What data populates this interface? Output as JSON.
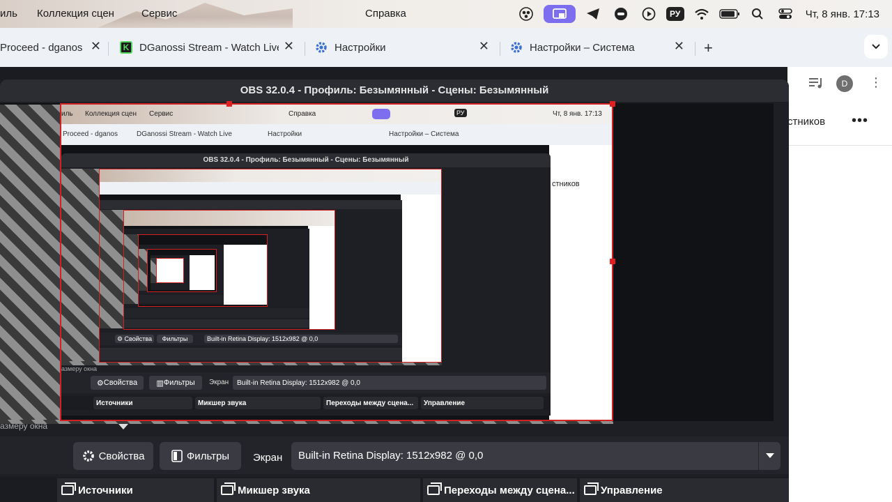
{
  "menubar": {
    "items": [
      "иль",
      "Коллекция сцен",
      "Сервис"
    ],
    "center_title": "Справка",
    "tray_icons": [
      "obs-icon",
      "screen-share-icon",
      "telegram-icon",
      "game-controller-icon",
      "play-circle-icon"
    ],
    "input_lang": "РУ",
    "clock": "Чт, 8 янв.  17:13"
  },
  "browser": {
    "tabs": [
      {
        "label": "Proceed - dganos",
        "icon": "page-icon"
      },
      {
        "label": "DGanossi Stream - Watch Live",
        "icon": "kick-icon"
      },
      {
        "label": "Настройки",
        "icon": "gear-icon"
      },
      {
        "label": "Настройки – Система",
        "icon": "gear-icon"
      }
    ],
    "new_tab": "+",
    "avatar_letter": "D",
    "page_header": "стников",
    "more": "•••"
  },
  "obs": {
    "title": "OBS 32.0.4 - Профиль: Безымянный - Сцены: Безымянный",
    "scale_label": "азмеру окна",
    "properties_button": "Свойства",
    "filters_button": "Фильтры",
    "source_label": "Экран",
    "source_value": "Built-in Retina Display: 1512x982 @ 0,0",
    "docks": [
      "Источники",
      "Микшер звука",
      "Переходы между сцена...",
      "Управление"
    ]
  },
  "nested": {
    "menu": [
      "иль",
      "Коллекция сцен",
      "Сервис"
    ],
    "center_title": "Справка",
    "clock": "Чт, 8 янв.  17:13",
    "ru": "РУ",
    "tabs": [
      "Proceed - dganos",
      "DGanossi Stream - Watch Live",
      "Настройки",
      "Настройки – Система"
    ],
    "title": "OBS 32.0.4 - Профиль: Безымянный - Сцены: Безымянный",
    "page_header": "стников",
    "scale_label": "азмеру окна",
    "properties_button": "Свойства",
    "filters_button": "Фильтры",
    "source_label": "Экран",
    "source_value": "Built-in Retina Display: 1512x982 @ 0,0",
    "docks": [
      "Источники",
      "Микшер звука",
      "Переходы между сцена...",
      "Управление"
    ]
  }
}
